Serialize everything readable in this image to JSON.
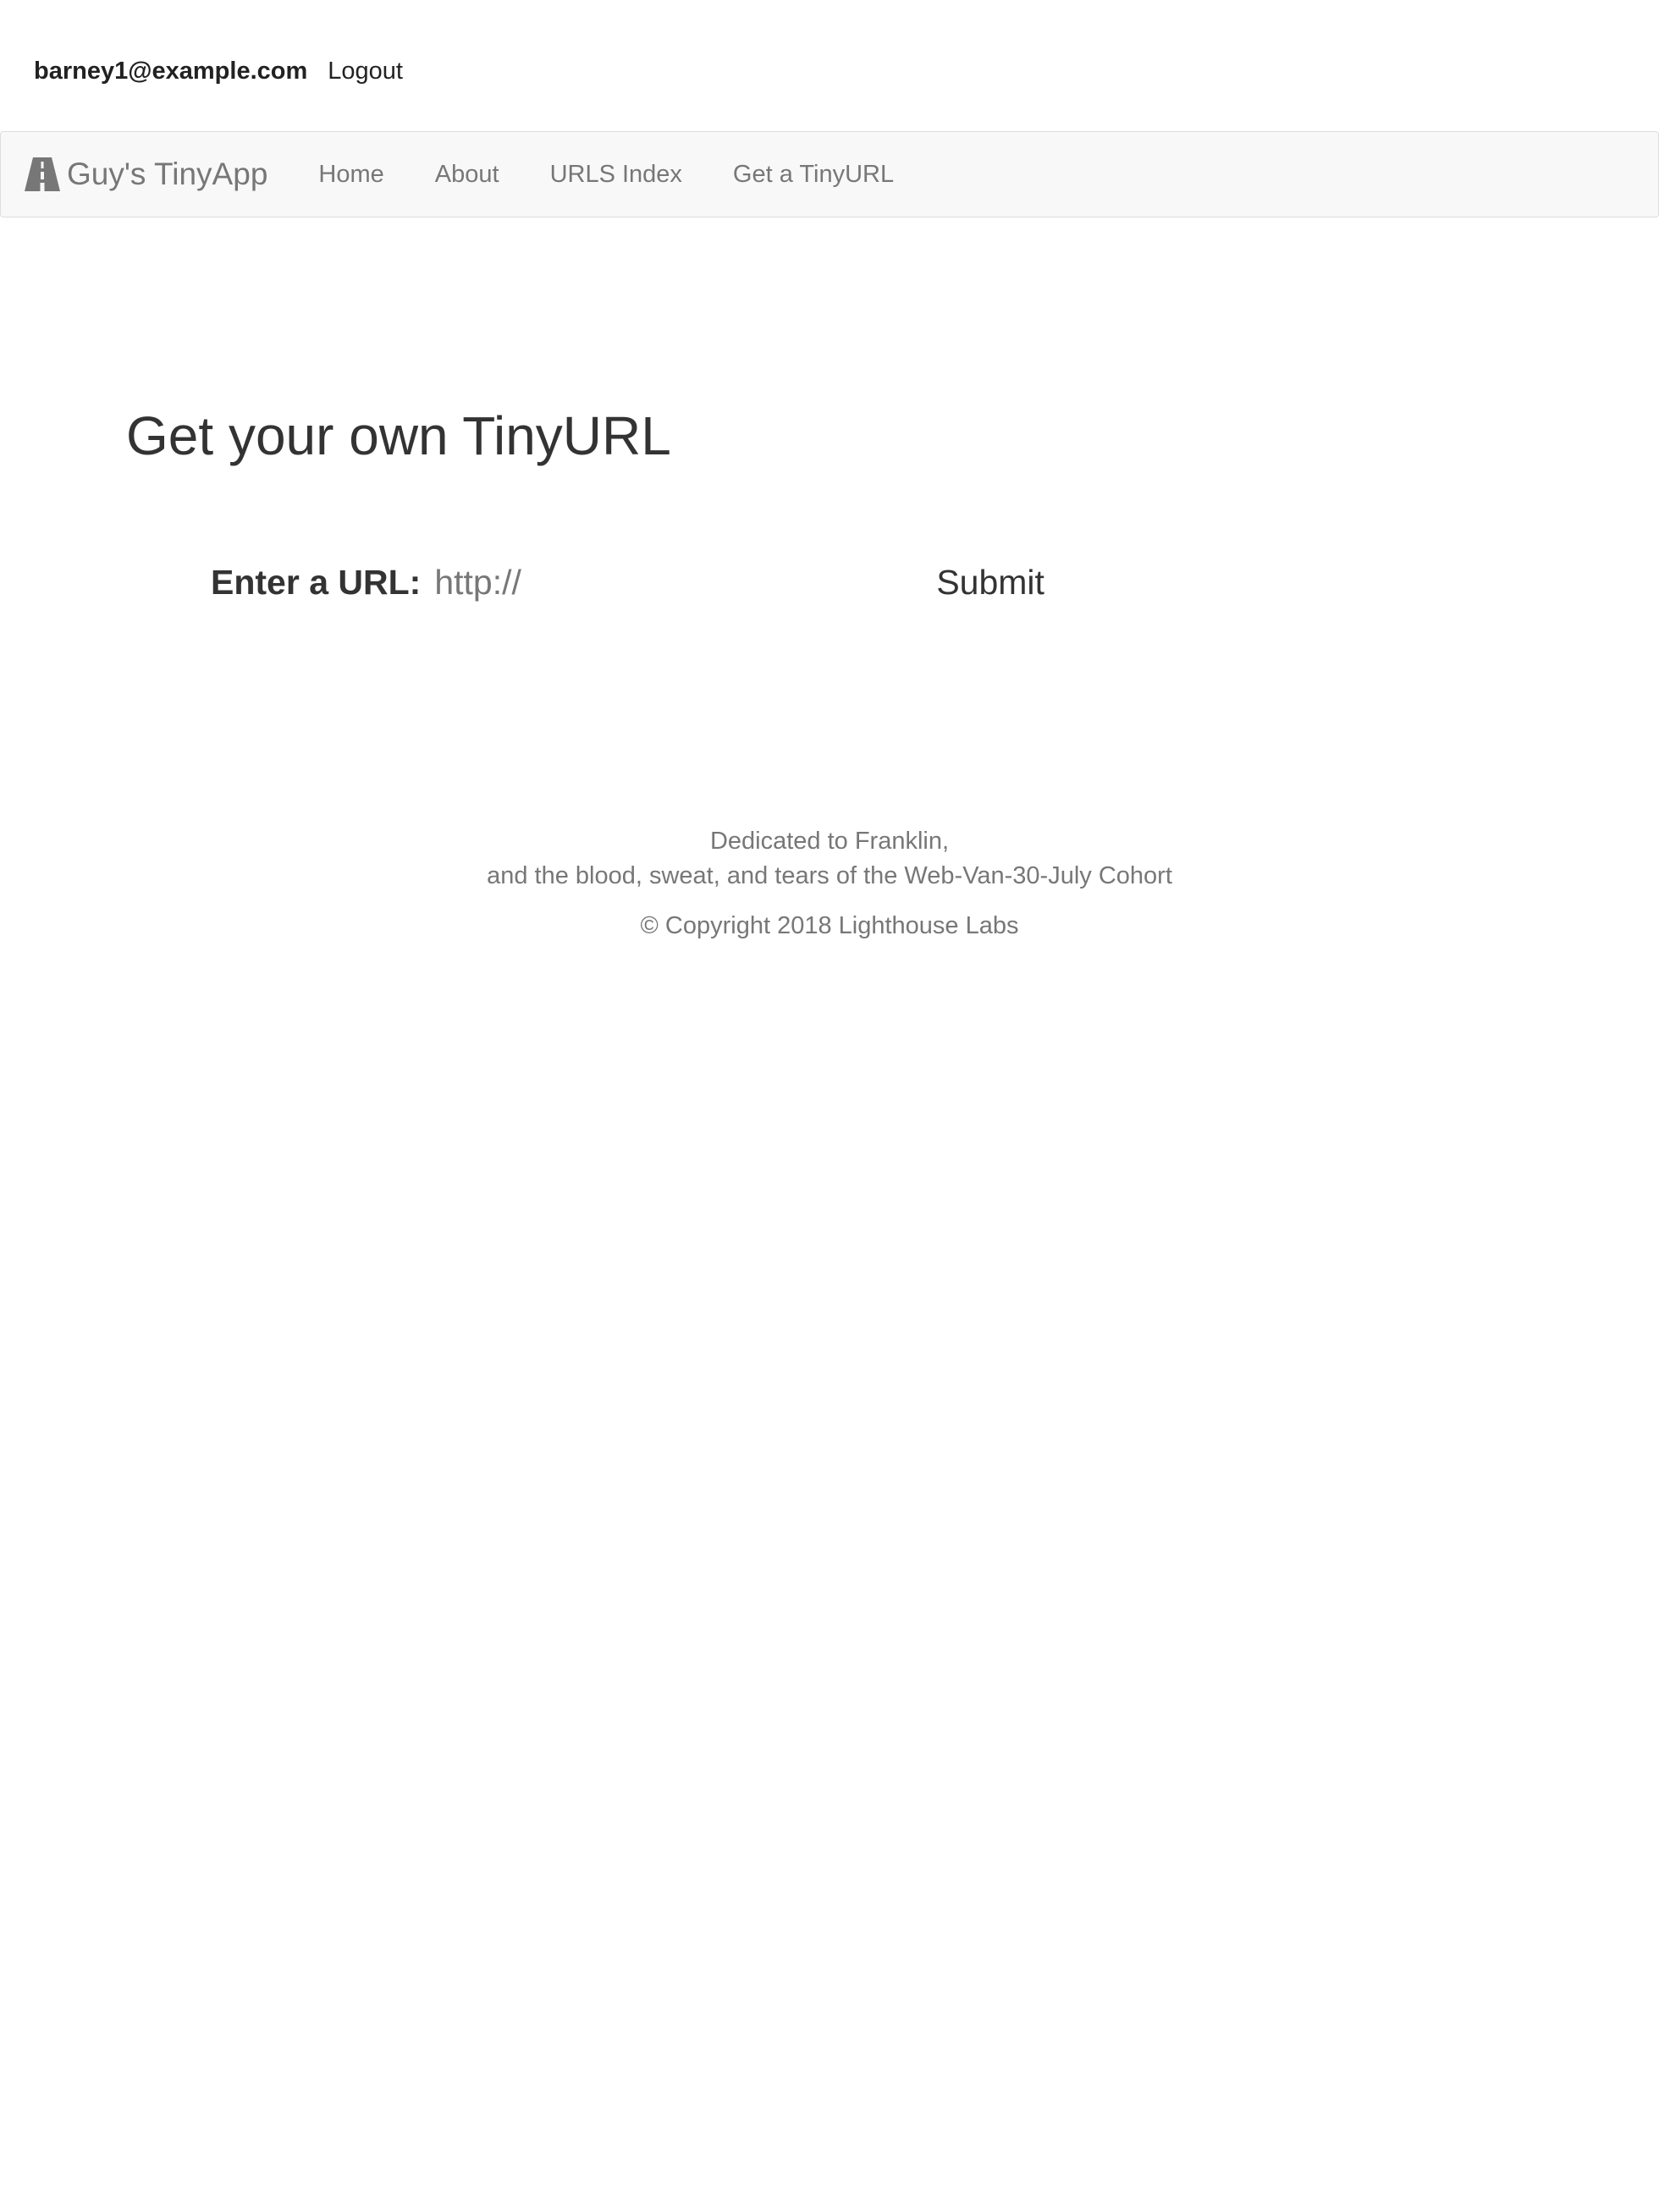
{
  "user": {
    "email": "barney1@example.com",
    "logout_label": "Logout"
  },
  "navbar": {
    "brand_icon": "road-icon",
    "brand": "Guy's TinyApp",
    "items": [
      {
        "label": "Home"
      },
      {
        "label": "About"
      },
      {
        "label": "URLS Index"
      },
      {
        "label": "Get a TinyURL"
      }
    ]
  },
  "main": {
    "title": "Get your own TinyURL",
    "form": {
      "label": "Enter a URL:",
      "placeholder": "http://",
      "value": "",
      "submit_label": "Submit"
    }
  },
  "footer": {
    "dedication_line1": "Dedicated to Franklin,",
    "dedication_line2": "and the blood, sweat, and tears of the Web-Van-30-July Cohort",
    "copyright": "© Copyright 2018 Lighthouse Labs"
  },
  "colors": {
    "navbar_bg": "#f8f8f8",
    "navbar_border": "#dddddd",
    "nav_text": "#777777",
    "body_text": "#333333"
  }
}
